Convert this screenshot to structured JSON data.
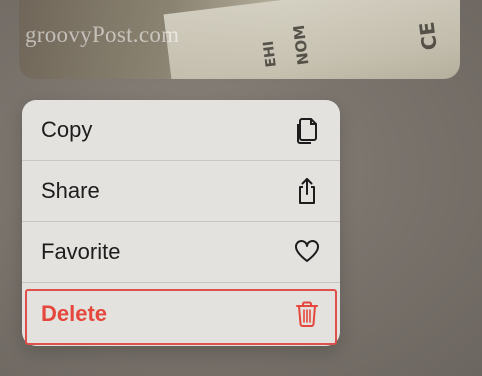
{
  "photo": {
    "watermark": "groovyPost.com",
    "marks": [
      "NOM",
      "EHI",
      "CE"
    ]
  },
  "menu": {
    "items": [
      {
        "label": "Copy",
        "icon": "copy-icon"
      },
      {
        "label": "Share",
        "icon": "share-icon"
      },
      {
        "label": "Favorite",
        "icon": "heart-icon"
      },
      {
        "label": "Delete",
        "icon": "trash-icon",
        "color": "#e5473c"
      }
    ]
  },
  "colors": {
    "destructive": "#e5473c",
    "highlight_border": "#e0504a",
    "menu_background": "#e4e2df"
  }
}
